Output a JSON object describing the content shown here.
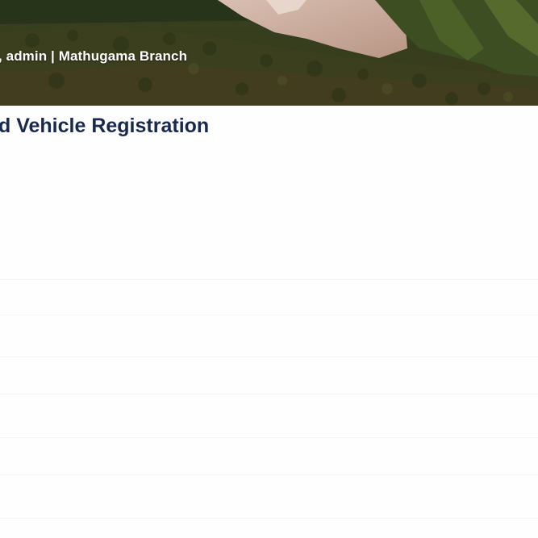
{
  "header": {
    "greeting": ", admin | Mathugama Branch"
  },
  "page": {
    "title": "d Vehicle Registration"
  },
  "colors": {
    "title": "#18284e",
    "banner_forest": "#2d3a1c",
    "banner_clearing": "#c9a99a"
  }
}
